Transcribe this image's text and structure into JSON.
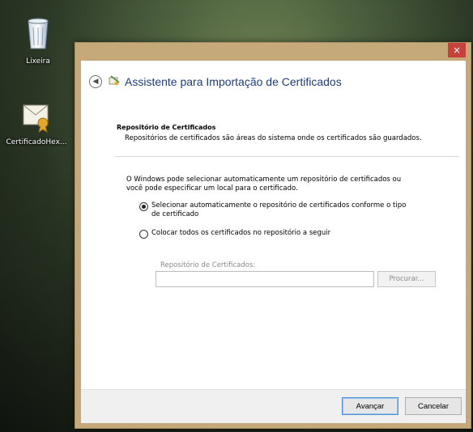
{
  "desktop": {
    "icons": [
      {
        "label": "Lixeira",
        "icon": "recycle-bin-icon"
      },
      {
        "label": "CertificadoHex...",
        "icon": "certificate-file-icon"
      }
    ]
  },
  "window": {
    "close_label": "×",
    "title": "Assistente para Importação de Certificados",
    "back_icon": "back-arrow-icon",
    "wizard_icon": "certificate-wizard-icon"
  },
  "section": {
    "title": "Repositório de Certificados",
    "description": "Repositórios de certificados são áreas do sistema onde os certificados são guardados."
  },
  "body": {
    "intro": "O Windows pode selecionar automaticamente um repositório de certificados ou você pode especificar um local para o certificado.",
    "options": [
      {
        "label": "Selecionar automaticamente o repositório de certificados conforme o tipo de certificado",
        "selected": true
      },
      {
        "label": "Colocar todos os certificados no repositório a seguir",
        "selected": false
      }
    ],
    "store_label": "Repositório de Certificados:",
    "store_value": "",
    "browse_label": "Procurar..."
  },
  "footer": {
    "next_label": "Avançar",
    "cancel_label": "Cancelar"
  },
  "colors": {
    "title_blue": "#1c3d78",
    "window_frame": "#c5a97b",
    "close_red": "#c7413b"
  }
}
